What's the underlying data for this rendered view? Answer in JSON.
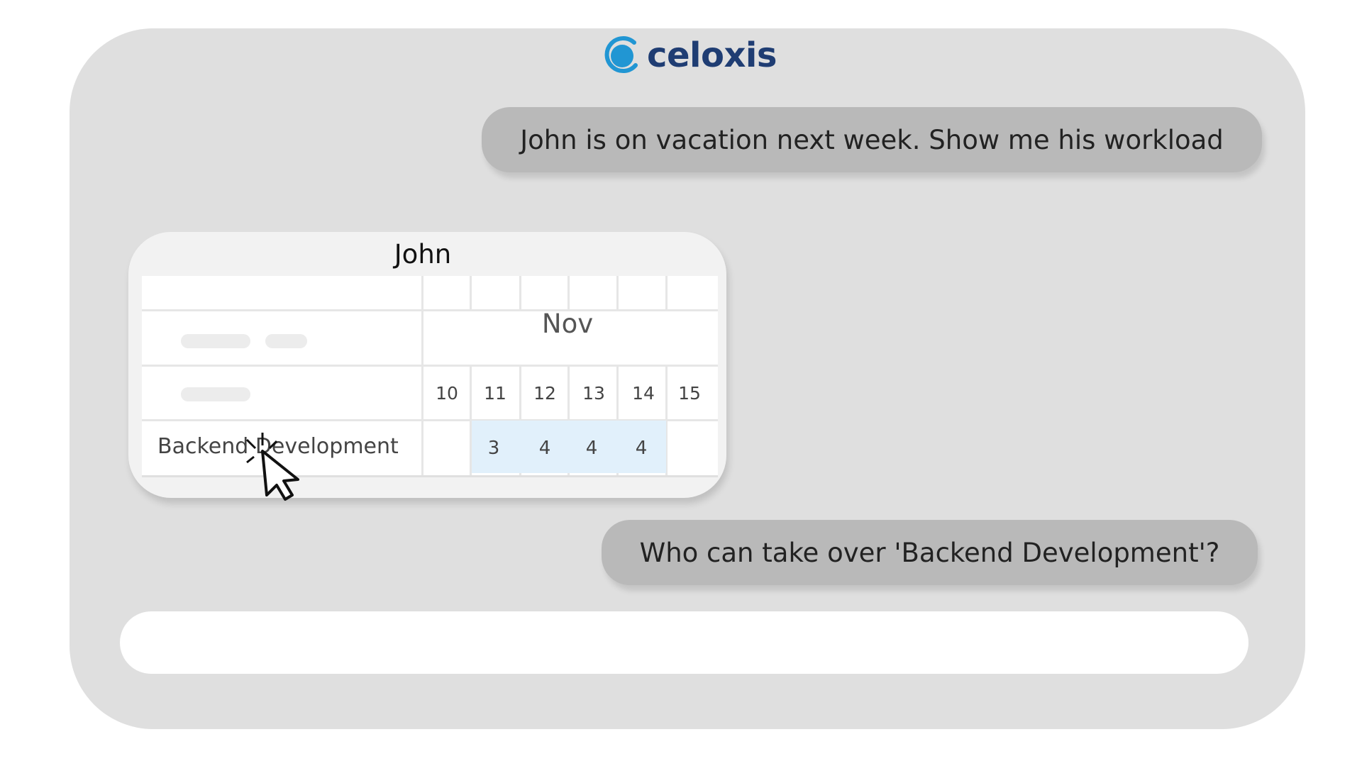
{
  "brand": {
    "name": "celoxis",
    "color": "#1f3d73",
    "accent": "#2196d3"
  },
  "messages": {
    "first": "John is on vacation next week. Show me his workload",
    "second": "Who can take over 'Backend Development'?"
  },
  "workload_card": {
    "title": "John",
    "month": "Nov",
    "days": [
      "10",
      "11",
      "12",
      "13",
      "14",
      "15"
    ],
    "task": "Backend Development",
    "hours": [
      "3",
      "4",
      "4",
      "4"
    ],
    "highlight_color": "#e1f0fb"
  },
  "input": {
    "placeholder": ""
  }
}
